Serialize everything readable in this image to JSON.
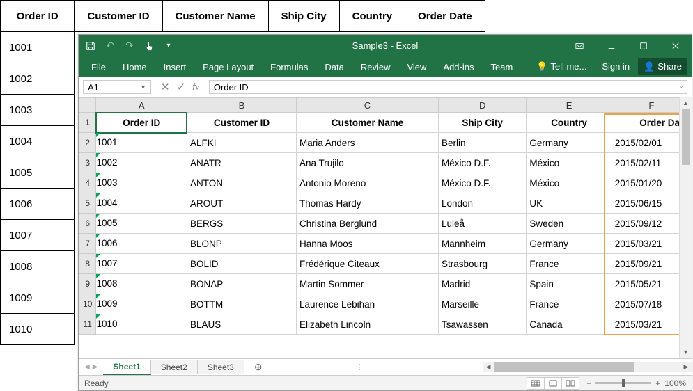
{
  "back_table": {
    "headers": [
      "Order ID",
      "Customer ID",
      "Customer Name",
      "Ship City",
      "Country",
      "Order Date"
    ],
    "rows_col1": [
      "1001",
      "1002",
      "1003",
      "1004",
      "1005",
      "1006",
      "1007",
      "1008",
      "1009",
      "1010"
    ]
  },
  "window": {
    "title": "Sample3 - Excel"
  },
  "ribbon": {
    "tabs": [
      "File",
      "Home",
      "Insert",
      "Page Layout",
      "Formulas",
      "Data",
      "Review",
      "View",
      "Add-ins",
      "Team"
    ],
    "tell_me": "Tell me...",
    "sign_in": "Sign in",
    "share": "Share"
  },
  "formula_bar": {
    "name_box": "A1",
    "formula": "Order ID"
  },
  "columns": [
    "A",
    "B",
    "C",
    "D",
    "E",
    "F"
  ],
  "header_row": [
    "Order ID",
    "Customer ID",
    "Customer Name",
    "Ship City",
    "Country",
    "Order Date"
  ],
  "data_rows": [
    [
      "1001",
      "ALFKI",
      "Maria Anders",
      "Berlin",
      "Germany",
      "2015/02/01"
    ],
    [
      "1002",
      "ANATR",
      "Ana Trujilo",
      "México D.F.",
      "México",
      "2015/02/11"
    ],
    [
      "1003",
      "ANTON",
      "Antonio Moreno",
      "México D.F.",
      "México",
      "2015/01/20"
    ],
    [
      "1004",
      "AROUT",
      "Thomas Hardy",
      "London",
      "UK",
      "2015/06/15"
    ],
    [
      "1005",
      "BERGS",
      "Christina Berglund",
      "Luleå",
      "Sweden",
      "2015/09/12"
    ],
    [
      "1006",
      "BLONP",
      "Hanna Moos",
      "Mannheim",
      "Germany",
      "2015/03/21"
    ],
    [
      "1007",
      "BOLID",
      "Frédérique Citeaux",
      "Strasbourg",
      "France",
      "2015/09/21"
    ],
    [
      "1008",
      "BONAP",
      "Martin Sommer",
      "Madrid",
      "Spain",
      "2015/05/21"
    ],
    [
      "1009",
      "BOTTM",
      "Laurence Lebihan",
      "Marseille",
      "France",
      "2015/07/18"
    ],
    [
      "1010",
      "BLAUS",
      "Elizabeth Lincoln",
      "Tsawassen",
      "Canada",
      "2015/03/21"
    ]
  ],
  "sheets": {
    "active": "Sheet1",
    "others": [
      "Sheet2",
      "Sheet3"
    ]
  },
  "status": {
    "text": "Ready",
    "zoom": "100%"
  }
}
